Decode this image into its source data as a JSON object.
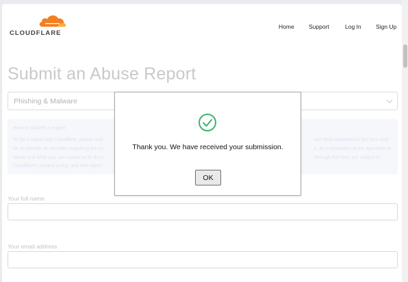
{
  "header": {
    "logo_text": "CLOUDFLARE",
    "nav": {
      "home": "Home",
      "support": "Support",
      "login": "Log In",
      "signup": "Sign Up"
    }
  },
  "main": {
    "title": "Submit an Abuse Report",
    "report_type": {
      "selected": "Phishing & Malware"
    },
    "info": {
      "heading": "How to submit a report",
      "lines_left": [
        "To file a report with Cloudflare, please sele",
        "be as specific as possible regarding the co",
        "abuse and what you can expect us to do in",
        "Cloudflare's privacy policy, and that report"
      ],
      "lines_right": [
        "ach field requested in the form and",
        "e. An explanation of our approach to",
        "through this form are subject to",
        ""
      ]
    },
    "fields": {
      "full_name_label": "Your full name",
      "full_name_value": "",
      "email_label": "Your email address",
      "email_value": ""
    }
  },
  "dialog": {
    "message": "Thank you. We have received your submission.",
    "ok_label": "OK"
  },
  "colors": {
    "brand_orange": "#f38020",
    "success_green": "#3cb371",
    "title_gray": "#c9c9c9"
  }
}
